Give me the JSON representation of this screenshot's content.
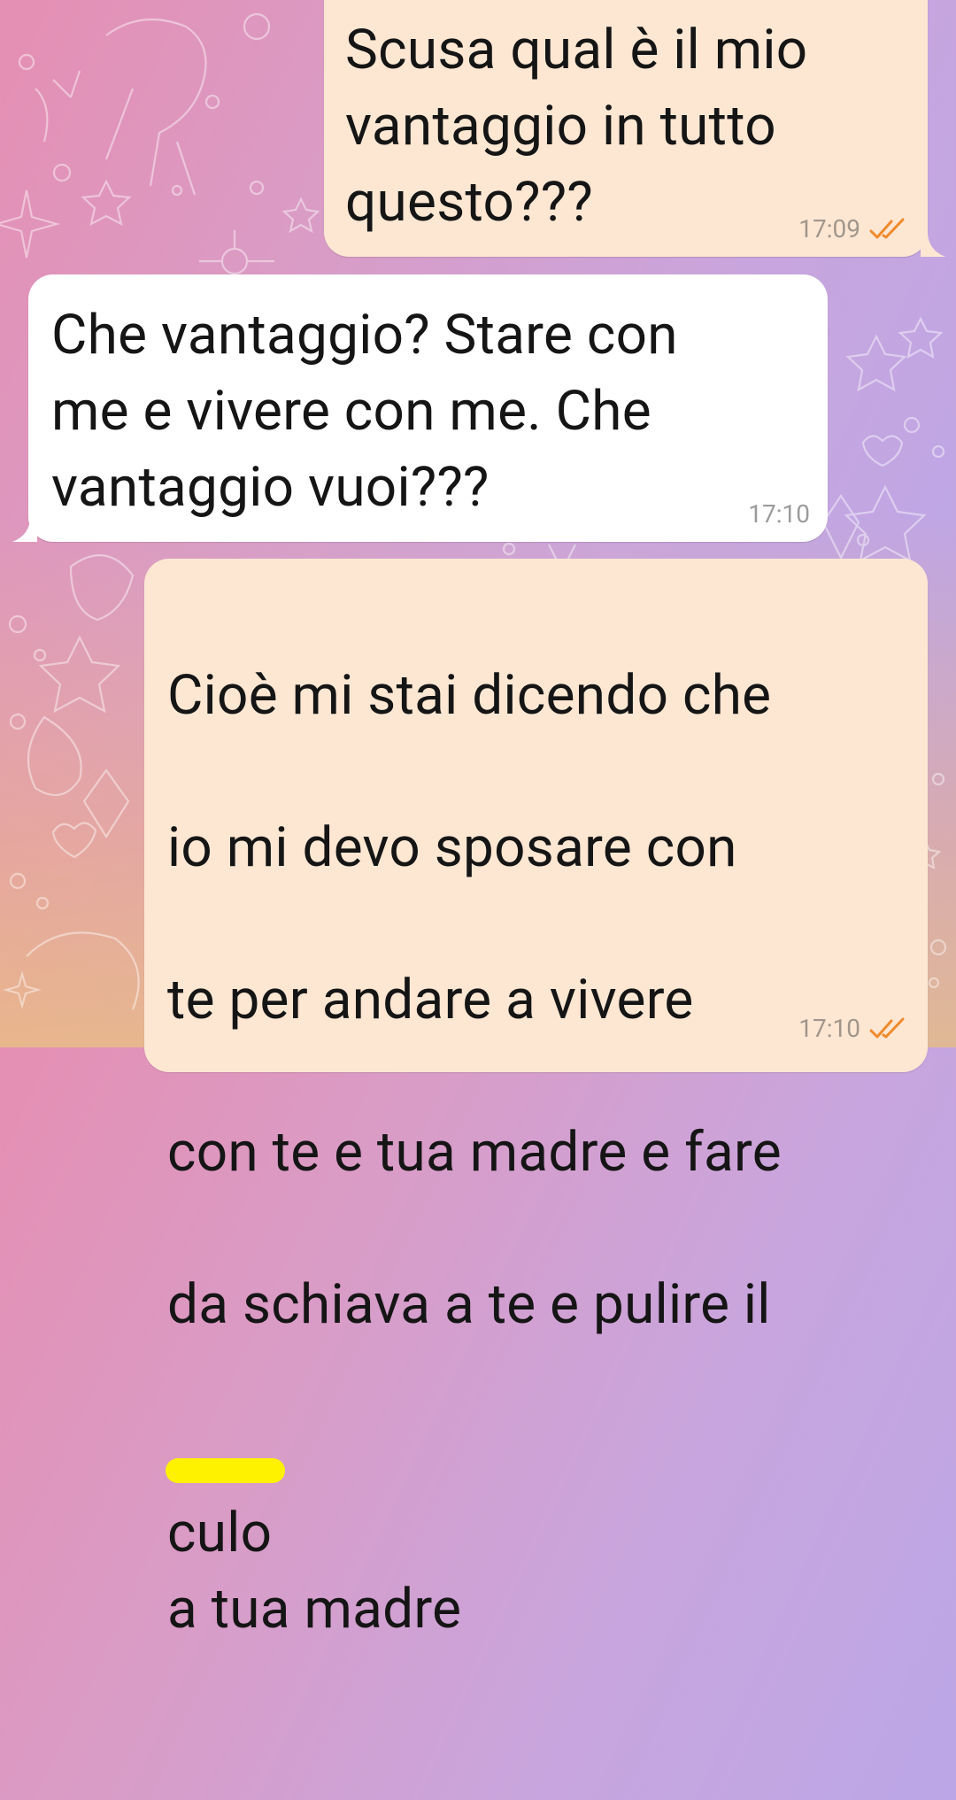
{
  "chat": {
    "messages": [
      {
        "direction": "outgoing",
        "text": "Scusa qual è il mio\nvantaggio in tutto\nquesto???",
        "time": "17:09",
        "status": "read"
      },
      {
        "direction": "incoming",
        "text": "Che vantaggio? Stare con\nme e vivere con me. Che\nvantaggio vuoi???",
        "time": "17:10"
      },
      {
        "direction": "outgoing",
        "text_lines": [
          "Cioè mi stai dicendo che",
          "io mi devo sposare con",
          "te per andare a vivere",
          "con te e tua madre e fare",
          "da schiava a te e pulire il"
        ],
        "last_line_censored_word": "culo",
        "last_line_rest": "a tua madre",
        "time": "17:10",
        "status": "read"
      }
    ]
  },
  "colors": {
    "outgoing_bubble": "#fde7d3",
    "incoming_bubble": "#ffffff",
    "read_ticks": "#f08a2c",
    "censor_highlight": "#fff200"
  },
  "icons": {
    "read_status": "double-check-icon",
    "wallpaper": "doodle-pattern"
  }
}
